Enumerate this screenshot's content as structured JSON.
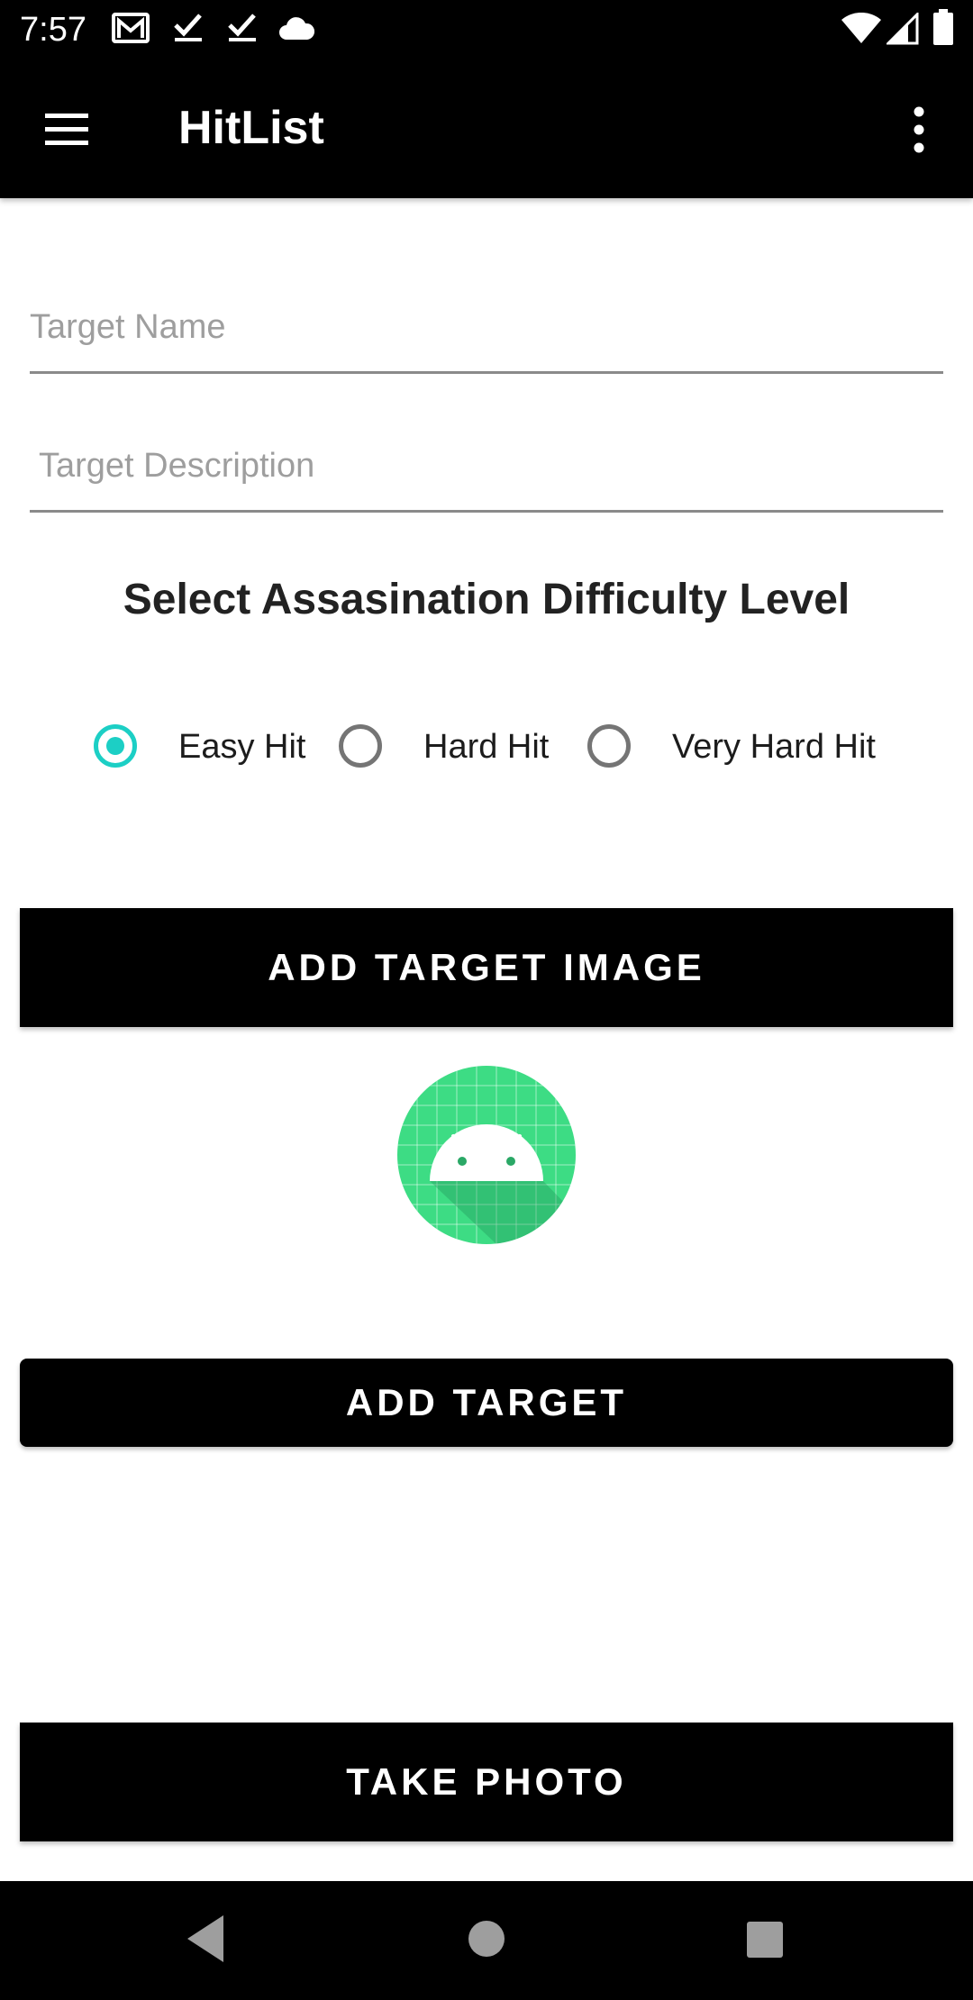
{
  "status_bar": {
    "time": "7:57",
    "left_icons": [
      "gmail-icon",
      "check-icon",
      "check-icon",
      "cloud-icon"
    ],
    "right_icons": [
      "wifi-icon",
      "signal-icon",
      "battery-icon"
    ]
  },
  "app_bar": {
    "title": "HitList",
    "menu_icon": "hamburger-menu-icon",
    "overflow_icon": "more-vert-icon"
  },
  "form": {
    "target_name_placeholder": "Target Name",
    "target_name_value": "",
    "target_description_placeholder": "Target Description",
    "target_description_value": "",
    "difficulty_heading": "Select Assasination Difficulty Level",
    "difficulty_options": [
      {
        "label": "Easy Hit",
        "selected": true
      },
      {
        "label": "Hard Hit",
        "selected": false
      },
      {
        "label": "Very Hard Hit",
        "selected": false
      }
    ]
  },
  "buttons": {
    "add_target_image": "ADD TARGET IMAGE",
    "add_target": "ADD TARGET",
    "take_photo": "TAKE PHOTO"
  },
  "target_image": {
    "icon": "android-placeholder-icon"
  },
  "colors": {
    "accent": "#1ccfc5",
    "bar_background": "#000000",
    "android_green": "#3ddc84"
  },
  "nav_bar": {
    "icons": [
      "back-icon",
      "home-icon",
      "recents-icon"
    ]
  }
}
